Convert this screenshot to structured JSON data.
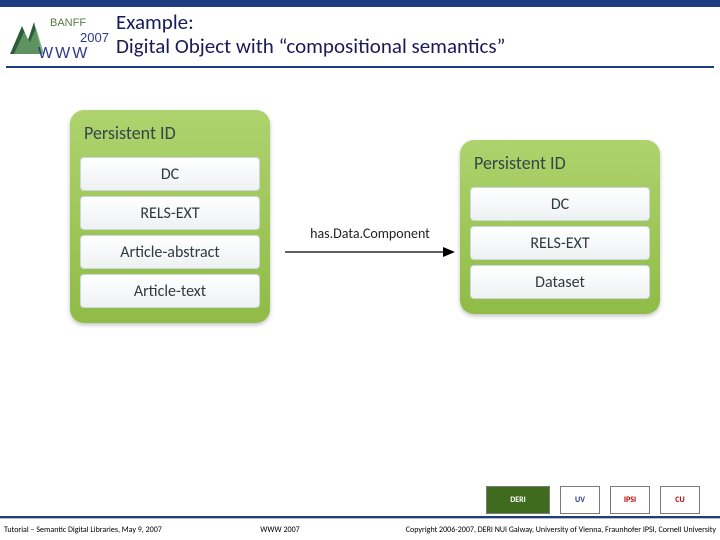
{
  "header": {
    "title_line1": "Example:",
    "title_line2": "Digital Object with “compositional semantics”",
    "conference_label": "BANFF",
    "conference_year": "2007",
    "conference_brand": "WWW"
  },
  "diagram": {
    "relation_label": "has.Data.Component",
    "left_object": {
      "pid_label": "Persistent ID",
      "components": [
        {
          "label": "DC"
        },
        {
          "label": "RELS-EXT"
        },
        {
          "label": "Article-abstract"
        },
        {
          "label": "Article-text"
        }
      ]
    },
    "right_object": {
      "pid_label": "Persistent ID",
      "components": [
        {
          "label": "DC"
        },
        {
          "label": "RELS-EXT"
        },
        {
          "label": "Dataset"
        }
      ]
    }
  },
  "footer": {
    "left": "Tutorial – Semantic Digital Libraries, May 9, 2007",
    "center": "WWW 2007",
    "right": "Copyright 2006-2007, DERI NUI Galway, University of Vienna, Fraunhofer IPSI, Cornell University"
  },
  "affiliation_logos": [
    {
      "name": "DERI"
    },
    {
      "name": "UV"
    },
    {
      "name": "IPSI"
    },
    {
      "name": "CU"
    }
  ]
}
